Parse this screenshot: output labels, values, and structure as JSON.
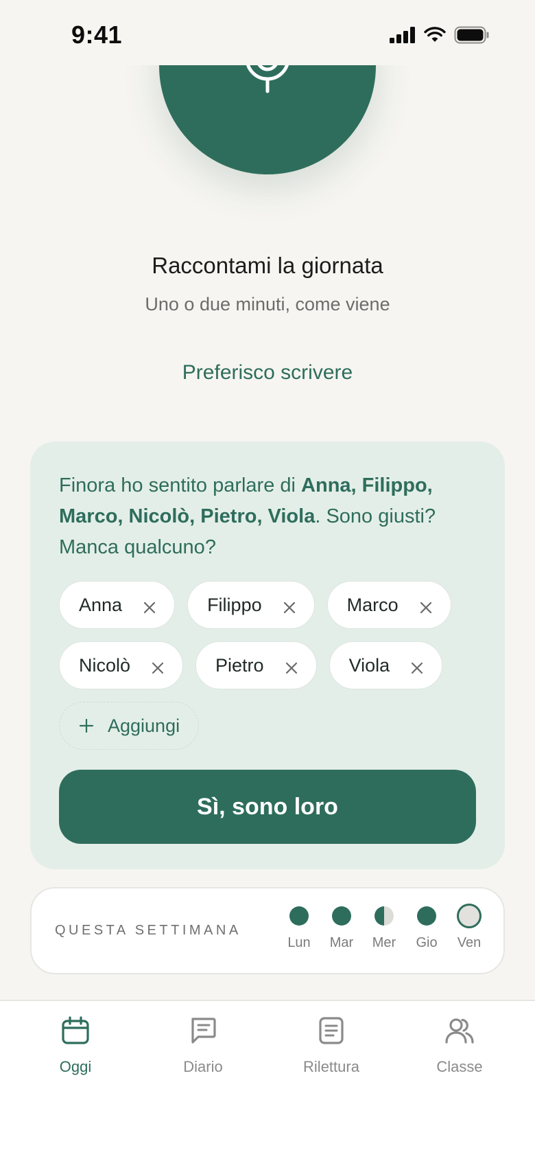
{
  "status_bar": {
    "time": "9:41",
    "icons": [
      "cellular-signal-icon",
      "wifi-icon",
      "battery-icon"
    ]
  },
  "recorder": {
    "icon": "microphone-icon",
    "title": "Raccontami la giornata",
    "subtitle": "Uno o due minuti, come viene",
    "write_link": "Preferisco scrivere"
  },
  "names_card": {
    "question_prefix": "Finora ho sentito parlare di ",
    "question_names": "Anna, Filippo, Marco, Nicolò, Pietro, Viola",
    "question_suffix": ". Sono giusti? Manca qualcuno?",
    "chips_row1": [
      "Anna",
      "Filippo",
      "Marco"
    ],
    "chips_row2": [
      "Nicolò",
      "Pietro",
      "Viola"
    ],
    "add_label": "Aggiungi",
    "confirm_label": "Sì, sono loro"
  },
  "week": {
    "label": "QUESTA SETTIMANA",
    "days": [
      {
        "label": "Lun",
        "status": "done"
      },
      {
        "label": "Mar",
        "status": "done"
      },
      {
        "label": "Mer",
        "status": "half"
      },
      {
        "label": "Gio",
        "status": "done"
      },
      {
        "label": "Ven",
        "status": "today"
      }
    ]
  },
  "tab_bar": {
    "tabs": [
      {
        "label": "Oggi",
        "icon": "calendar-icon",
        "active": true
      },
      {
        "label": "Diario",
        "icon": "journal-icon",
        "active": false
      },
      {
        "label": "Rilettura",
        "icon": "document-icon",
        "active": false
      },
      {
        "label": "Classe",
        "icon": "users-icon",
        "active": false
      }
    ]
  },
  "colors": {
    "accent": "#2e6d5c",
    "background": "#f6f5f1",
    "card_background": "#e4eee8"
  }
}
